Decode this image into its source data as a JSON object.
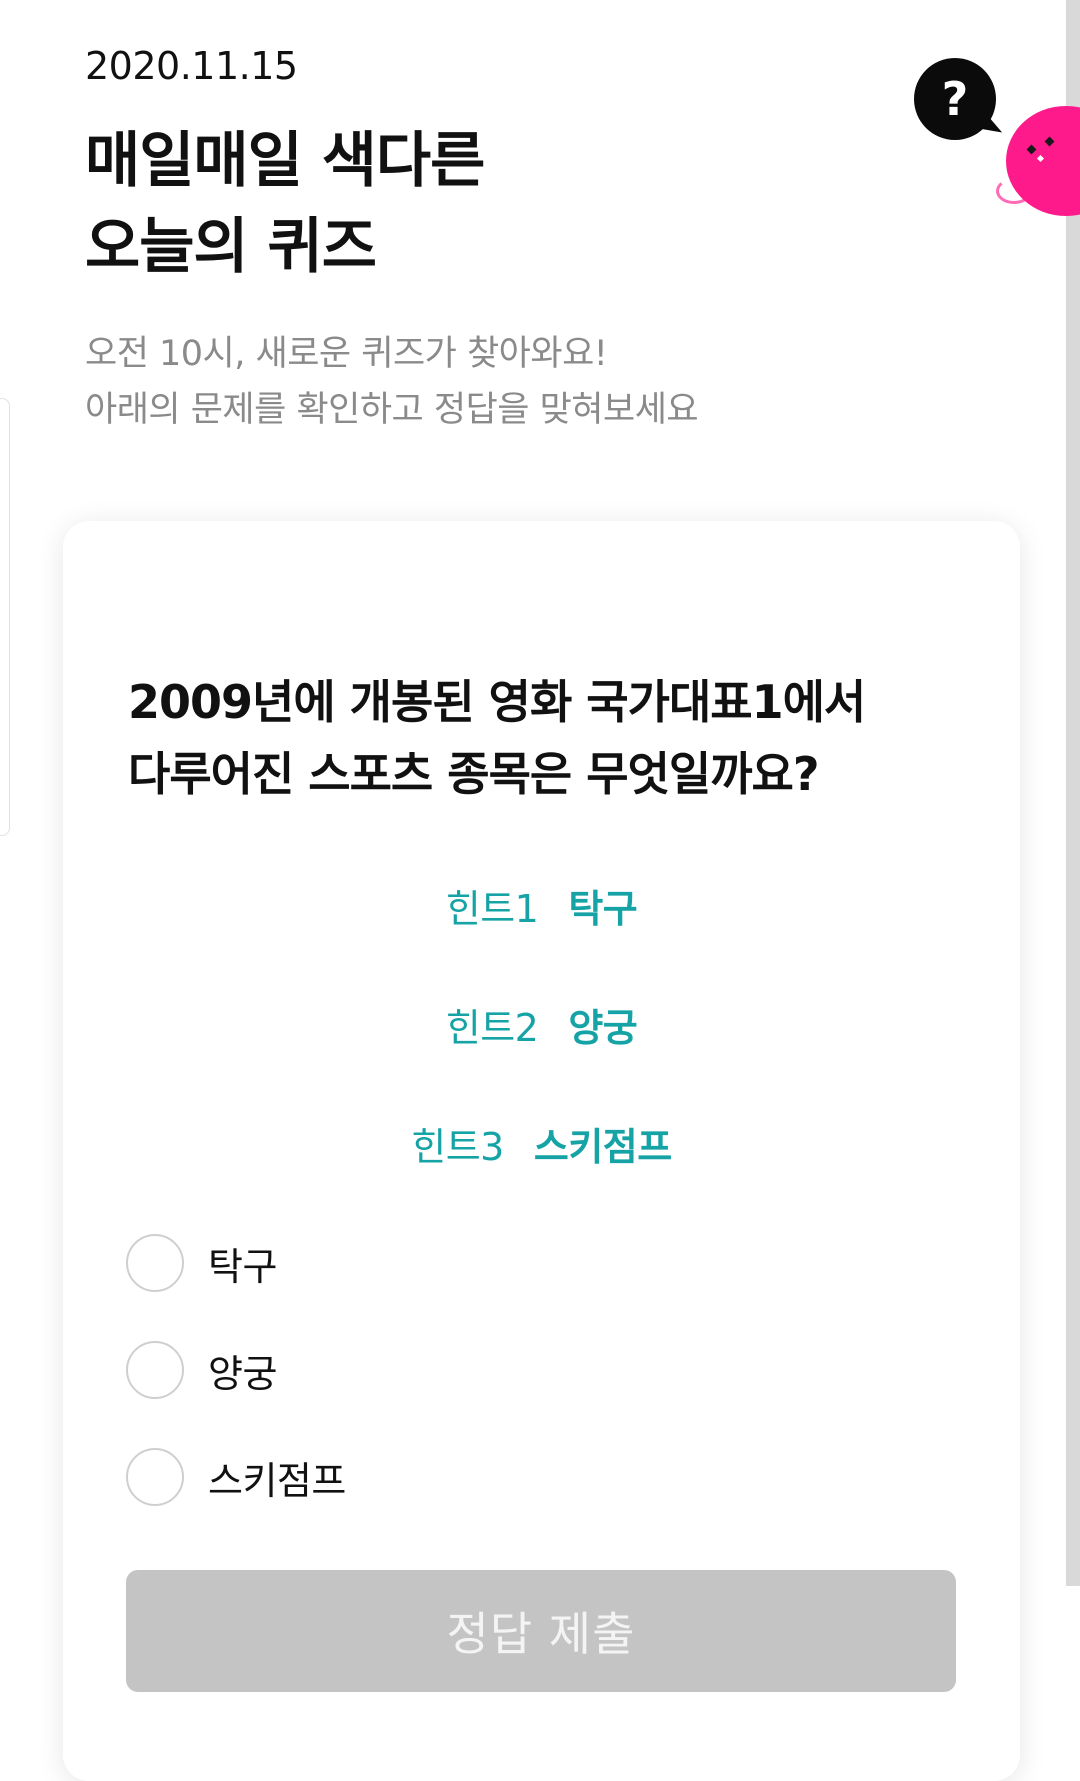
{
  "header": {
    "date": "2020.11.15",
    "title_line1": "매일매일 색다른",
    "title_line2": "오늘의 퀴즈",
    "subtitle_line1": "오전 10시, 새로운 퀴즈가 찾아와요!",
    "subtitle_line2": "아래의 문제를 확인하고 정답을 맞혀보세요",
    "help_icon": "?"
  },
  "quiz": {
    "question_line1": "2009년에 개봉된 영화 국가대표1에서",
    "question_line2": "다루어진 스포츠 종목은 무엇일까요?",
    "hints": [
      {
        "label": "힌트1",
        "value": "탁구"
      },
      {
        "label": "힌트2",
        "value": "양궁"
      },
      {
        "label": "힌트3",
        "value": "스키점프"
      }
    ],
    "options": [
      {
        "label": "탁구",
        "selected": false
      },
      {
        "label": "양궁",
        "selected": false
      },
      {
        "label": "스키점프",
        "selected": false
      }
    ],
    "submit_label": "정답 제출"
  },
  "colors": {
    "hint_teal": "#16a3a6",
    "mascot_pink": "#ff1a8c",
    "submit_disabled": "#c4c4c4"
  },
  "icons": {
    "help": "help-bubble-icon",
    "mascot": "mascot-icon",
    "radio": "radio-circle-icon"
  }
}
